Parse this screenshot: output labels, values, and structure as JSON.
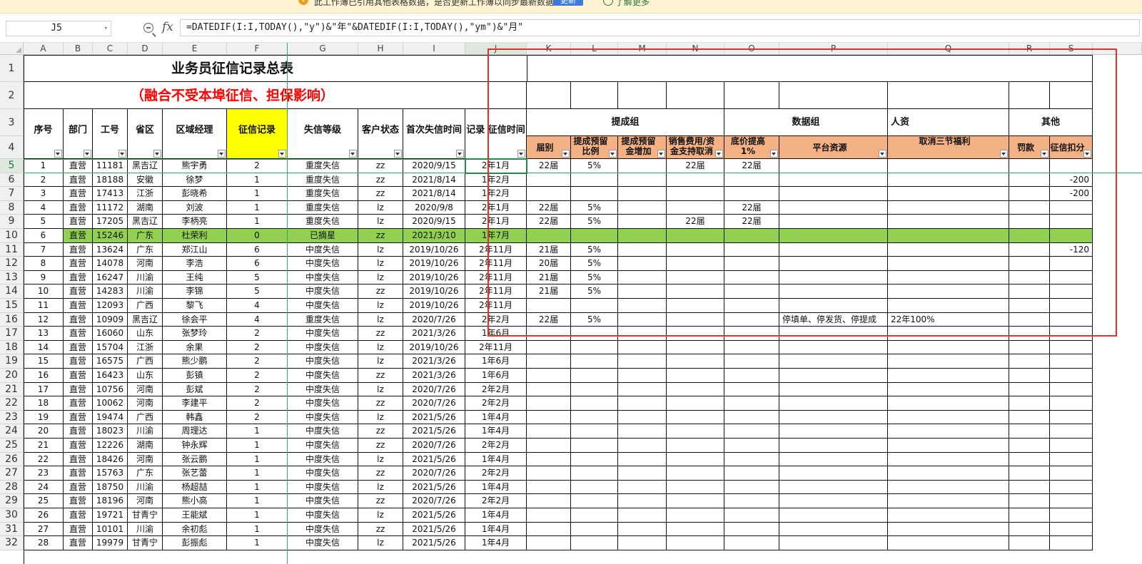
{
  "notice": {
    "text": "此工作薄已引用其他表格数据，是否更新工作薄以同步最新数据？",
    "update_button": "更新",
    "learn_more": "了解更多"
  },
  "formula_bar": {
    "name_box": "J5",
    "fx_label": "fx",
    "formula": "=DATEDIF(I:I,TODAY(),\"y\")&\"年\"&DATEDIF(I:I,TODAY(),\"ym\")&\"月\""
  },
  "sheet": {
    "title": "业务员征信记录总表",
    "subtitle": "（融合不受本埠征信、担保影响）",
    "columns": [
      "A",
      "B",
      "C",
      "D",
      "E",
      "F",
      "G",
      "H",
      "I",
      "J",
      "K",
      "L",
      "M",
      "N",
      "O",
      "P",
      "Q",
      "R",
      "S"
    ],
    "selected_column": "J",
    "row_numbers": [
      "1",
      "2",
      "3",
      "4",
      "5",
      "6",
      "7",
      "8",
      "9",
      "10",
      "11",
      "12",
      "13",
      "14",
      "15",
      "16",
      "17",
      "18",
      "19",
      "20",
      "21",
      "22",
      "23",
      "24",
      "25",
      "26",
      "27",
      "28",
      "29",
      "30",
      "31",
      "32"
    ],
    "selected_row": "5",
    "headers_left": [
      "序号",
      "部门",
      "工号",
      "省区",
      "区域经理",
      "征信记录",
      "失信等级",
      "客户状态",
      "首次失信时间",
      "记录 征信时间"
    ],
    "groups": {
      "commission": "提成组",
      "data": "数据组",
      "hr": "人资",
      "other": "其他"
    },
    "headers_right": [
      "届别",
      "提成预留比例",
      "提成预留金增加",
      "销售费用/资金支持取消",
      "底价提高1%",
      "平台资源",
      "取消三节福利",
      "罚款",
      "征信扣分"
    ],
    "rows": [
      {
        "row": "5",
        "seq": "1",
        "dept": "直营",
        "id": "11181",
        "prov": "黑吉辽",
        "mgr": "熊宇勇",
        "rec": "2",
        "level": "重度失信",
        "status": "zz",
        "date": "2020/9/15",
        "dur": "2年1月",
        "k": "22届",
        "l": "5%",
        "m": "",
        "n": "22届",
        "o": "22届",
        "p": "",
        "q": "",
        "r": "",
        "s": ""
      },
      {
        "row": "6",
        "seq": "2",
        "dept": "直营",
        "id": "18188",
        "prov": "安徽",
        "mgr": "徐梦",
        "rec": "1",
        "level": "重度失信",
        "status": "zz",
        "date": "2021/8/14",
        "dur": "1年2月",
        "k": "",
        "l": "",
        "m": "",
        "n": "",
        "o": "",
        "p": "",
        "q": "",
        "r": "",
        "s": "-200"
      },
      {
        "row": "7",
        "seq": "3",
        "dept": "直营",
        "id": "17413",
        "prov": "江浙",
        "mgr": "彭晓希",
        "rec": "1",
        "level": "重度失信",
        "status": "zz",
        "date": "2021/8/14",
        "dur": "1年2月",
        "k": "",
        "l": "",
        "m": "",
        "n": "",
        "o": "",
        "p": "",
        "q": "",
        "r": "",
        "s": "-200"
      },
      {
        "row": "8",
        "seq": "4",
        "dept": "直营",
        "id": "11172",
        "prov": "湖南",
        "mgr": "刘波",
        "rec": "1",
        "level": "重度失信",
        "status": "lz",
        "date": "2020/9/8",
        "dur": "2年1月",
        "k": "22届",
        "l": "5%",
        "m": "",
        "n": "",
        "o": "22届",
        "p": "",
        "q": "",
        "r": "",
        "s": ""
      },
      {
        "row": "9",
        "seq": "5",
        "dept": "直营",
        "id": "17205",
        "prov": "黑吉辽",
        "mgr": "李柄亮",
        "rec": "1",
        "level": "重度失信",
        "status": "lz",
        "date": "2020/9/15",
        "dur": "2年1月",
        "k": "22届",
        "l": "5%",
        "m": "",
        "n": "22届",
        "o": "22届",
        "p": "",
        "q": "",
        "r": "",
        "s": ""
      },
      {
        "row": "10",
        "seq": "6",
        "dept": "直营",
        "id": "15246",
        "prov": "广东",
        "mgr": "杜荣利",
        "rec": "0",
        "level": "已摘星",
        "status": "zz",
        "date": "2021/3/10",
        "dur": "1年7月",
        "k": "",
        "l": "",
        "m": "",
        "n": "",
        "o": "",
        "p": "",
        "q": "",
        "r": "",
        "s": "",
        "green": true
      },
      {
        "row": "11",
        "seq": "7",
        "dept": "直营",
        "id": "13624",
        "prov": "广东",
        "mgr": "郑江山",
        "rec": "6",
        "level": "中度失信",
        "status": "lz",
        "date": "2019/10/26",
        "dur": "2年11月",
        "k": "21届",
        "l": "5%",
        "m": "",
        "n": "",
        "o": "",
        "p": "",
        "q": "",
        "r": "",
        "s": "-120"
      },
      {
        "row": "12",
        "seq": "8",
        "dept": "直营",
        "id": "14078",
        "prov": "河南",
        "mgr": "李浩",
        "rec": "6",
        "level": "中度失信",
        "status": "lz",
        "date": "2019/10/26",
        "dur": "2年11月",
        "k": "20届",
        "l": "5%",
        "m": "",
        "n": "",
        "o": "",
        "p": "",
        "q": "",
        "r": "",
        "s": ""
      },
      {
        "row": "13",
        "seq": "9",
        "dept": "直营",
        "id": "16247",
        "prov": "川渝",
        "mgr": "王纯",
        "rec": "5",
        "level": "中度失信",
        "status": "lz",
        "date": "2019/10/26",
        "dur": "2年11月",
        "k": "21届",
        "l": "5%",
        "m": "",
        "n": "",
        "o": "",
        "p": "",
        "q": "",
        "r": "",
        "s": ""
      },
      {
        "row": "14",
        "seq": "10",
        "dept": "直营",
        "id": "14283",
        "prov": "川渝",
        "mgr": "李锦",
        "rec": "5",
        "level": "中度失信",
        "status": "zz",
        "date": "2019/10/26",
        "dur": "2年11月",
        "k": "21届",
        "l": "5%",
        "m": "",
        "n": "",
        "o": "",
        "p": "",
        "q": "",
        "r": "",
        "s": ""
      },
      {
        "row": "15",
        "seq": "11",
        "dept": "直营",
        "id": "12093",
        "prov": "广西",
        "mgr": "黎飞",
        "rec": "4",
        "level": "中度失信",
        "status": "lz",
        "date": "2019/10/26",
        "dur": "2年11月",
        "k": "",
        "l": "",
        "m": "",
        "n": "",
        "o": "",
        "p": "",
        "q": "",
        "r": "",
        "s": ""
      },
      {
        "row": "16",
        "seq": "12",
        "dept": "直营",
        "id": "10909",
        "prov": "黑吉辽",
        "mgr": "徐会平",
        "rec": "4",
        "level": "重度失信",
        "status": "lz",
        "date": "2020/7/26",
        "dur": "2年2月",
        "k": "22届",
        "l": "5%",
        "m": "",
        "n": "",
        "o": "",
        "p": "停填单、停发货、停提成",
        "q": "22年100%",
        "r": "",
        "s": ""
      },
      {
        "row": "17",
        "seq": "13",
        "dept": "直营",
        "id": "16060",
        "prov": "山东",
        "mgr": "张梦玲",
        "rec": "2",
        "level": "中度失信",
        "status": "zz",
        "date": "2021/3/26",
        "dur": "1年6月",
        "k": "",
        "l": "",
        "m": "",
        "n": "",
        "o": "",
        "p": "",
        "q": "",
        "r": "",
        "s": ""
      },
      {
        "row": "18",
        "seq": "14",
        "dept": "直营",
        "id": "15704",
        "prov": "江浙",
        "mgr": "余果",
        "rec": "2",
        "level": "中度失信",
        "status": "lz",
        "date": "2019/10/26",
        "dur": "2年11月",
        "k": "",
        "l": "",
        "m": "",
        "n": "",
        "o": "",
        "p": "",
        "q": "",
        "r": "",
        "s": ""
      },
      {
        "row": "19",
        "seq": "15",
        "dept": "直营",
        "id": "16575",
        "prov": "广西",
        "mgr": "熊少鹏",
        "rec": "2",
        "level": "中度失信",
        "status": "lz",
        "date": "2021/3/26",
        "dur": "1年6月",
        "k": "",
        "l": "",
        "m": "",
        "n": "",
        "o": "",
        "p": "",
        "q": "",
        "r": "",
        "s": ""
      },
      {
        "row": "20",
        "seq": "16",
        "dept": "直营",
        "id": "16423",
        "prov": "山东",
        "mgr": "彭镇",
        "rec": "2",
        "level": "中度失信",
        "status": "zz",
        "date": "2021/3/26",
        "dur": "1年6月",
        "k": "",
        "l": "",
        "m": "",
        "n": "",
        "o": "",
        "p": "",
        "q": "",
        "r": "",
        "s": ""
      },
      {
        "row": "21",
        "seq": "17",
        "dept": "直营",
        "id": "10756",
        "prov": "河南",
        "mgr": "彭斌",
        "rec": "2",
        "level": "中度失信",
        "status": "lz",
        "date": "2020/7/26",
        "dur": "2年2月",
        "k": "",
        "l": "",
        "m": "",
        "n": "",
        "o": "",
        "p": "",
        "q": "",
        "r": "",
        "s": ""
      },
      {
        "row": "22",
        "seq": "18",
        "dept": "直营",
        "id": "10062",
        "prov": "河南",
        "mgr": "李建平",
        "rec": "2",
        "level": "中度失信",
        "status": "zz",
        "date": "2020/7/26",
        "dur": "2年2月",
        "k": "",
        "l": "",
        "m": "",
        "n": "",
        "o": "",
        "p": "",
        "q": "",
        "r": "",
        "s": ""
      },
      {
        "row": "23",
        "seq": "19",
        "dept": "直营",
        "id": "19474",
        "prov": "广西",
        "mgr": "韩鑫",
        "rec": "2",
        "level": "中度失信",
        "status": "lz",
        "date": "2021/5/26",
        "dur": "1年4月",
        "k": "",
        "l": "",
        "m": "",
        "n": "",
        "o": "",
        "p": "",
        "q": "",
        "r": "",
        "s": ""
      },
      {
        "row": "24",
        "seq": "20",
        "dept": "直营",
        "id": "18023",
        "prov": "川渝",
        "mgr": "周理达",
        "rec": "1",
        "level": "中度失信",
        "status": "zz",
        "date": "2021/5/26",
        "dur": "1年4月",
        "k": "",
        "l": "",
        "m": "",
        "n": "",
        "o": "",
        "p": "",
        "q": "",
        "r": "",
        "s": ""
      },
      {
        "row": "25",
        "seq": "21",
        "dept": "直营",
        "id": "12226",
        "prov": "湖南",
        "mgr": "钟永辉",
        "rec": "1",
        "level": "中度失信",
        "status": "zz",
        "date": "2020/7/26",
        "dur": "2年2月",
        "k": "",
        "l": "",
        "m": "",
        "n": "",
        "o": "",
        "p": "",
        "q": "",
        "r": "",
        "s": ""
      },
      {
        "row": "26",
        "seq": "22",
        "dept": "直营",
        "id": "18426",
        "prov": "河南",
        "mgr": "张云鹏",
        "rec": "1",
        "level": "中度失信",
        "status": "lz",
        "date": "2021/5/26",
        "dur": "1年4月",
        "k": "",
        "l": "",
        "m": "",
        "n": "",
        "o": "",
        "p": "",
        "q": "",
        "r": "",
        "s": ""
      },
      {
        "row": "27",
        "seq": "23",
        "dept": "直营",
        "id": "15763",
        "prov": "广东",
        "mgr": "张艺蕾",
        "rec": "1",
        "level": "中度失信",
        "status": "zz",
        "date": "2020/7/26",
        "dur": "2年2月",
        "k": "",
        "l": "",
        "m": "",
        "n": "",
        "o": "",
        "p": "",
        "q": "",
        "r": "",
        "s": ""
      },
      {
        "row": "28",
        "seq": "24",
        "dept": "直营",
        "id": "18750",
        "prov": "川渝",
        "mgr": "杨超喆",
        "rec": "1",
        "level": "中度失信",
        "status": "lz",
        "date": "2021/5/26",
        "dur": "1年4月",
        "k": "",
        "l": "",
        "m": "",
        "n": "",
        "o": "",
        "p": "",
        "q": "",
        "r": "",
        "s": ""
      },
      {
        "row": "29",
        "seq": "25",
        "dept": "直营",
        "id": "18196",
        "prov": "河南",
        "mgr": "熊小高",
        "rec": "1",
        "level": "中度失信",
        "status": "zz",
        "date": "2020/7/26",
        "dur": "2年2月",
        "k": "",
        "l": "",
        "m": "",
        "n": "",
        "o": "",
        "p": "",
        "q": "",
        "r": "",
        "s": ""
      },
      {
        "row": "30",
        "seq": "26",
        "dept": "直营",
        "id": "19721",
        "prov": "甘青宁",
        "mgr": "王能斌",
        "rec": "1",
        "level": "中度失信",
        "status": "lz",
        "date": "2021/5/26",
        "dur": "1年4月",
        "k": "",
        "l": "",
        "m": "",
        "n": "",
        "o": "",
        "p": "",
        "q": "",
        "r": "",
        "s": ""
      },
      {
        "row": "31",
        "seq": "27",
        "dept": "直营",
        "id": "10101",
        "prov": "川渝",
        "mgr": "余初彪",
        "rec": "1",
        "level": "中度失信",
        "status": "zz",
        "date": "2021/5/26",
        "dur": "1年4月",
        "k": "",
        "l": "",
        "m": "",
        "n": "",
        "o": "",
        "p": "",
        "q": "",
        "r": "",
        "s": ""
      },
      {
        "row": "32",
        "seq": "28",
        "dept": "直营",
        "id": "19979",
        "prov": "甘青宁",
        "mgr": "彭振彪",
        "rec": "1",
        "level": "中度失信",
        "status": "lz",
        "date": "2021/5/26",
        "dur": "1年4月",
        "k": "",
        "l": "",
        "m": "",
        "n": "",
        "o": "",
        "p": "",
        "q": "",
        "r": "",
        "s": ""
      }
    ]
  },
  "colors": {
    "header_fill": "#f4b183",
    "yellow_fill": "#ffff00",
    "green_row_fill": "#92d050",
    "title_red": "#ff0000",
    "selection_green": "#1f8a4c",
    "annotation_red": "#e8302a"
  },
  "icons": {
    "notice": "warning-icon",
    "zoom": "zoom-icon",
    "fx": "function-icon",
    "filter": "filter-dropdown-icon"
  }
}
